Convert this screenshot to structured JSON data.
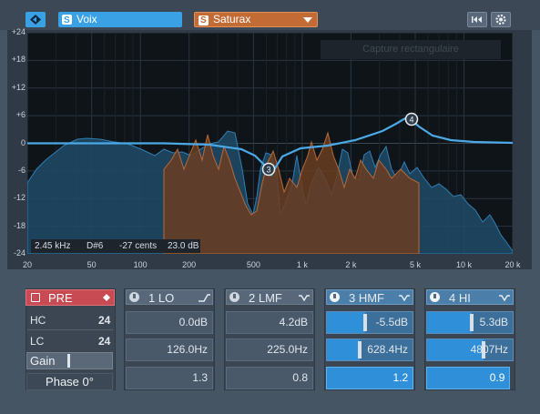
{
  "topbar": {
    "channel_name": "Voix",
    "insert_name": "Saturax",
    "reset_icon": "skip-back-icon",
    "settings_icon": "gear-icon"
  },
  "graph": {
    "y_ticks": [
      "+24",
      "+18",
      "+12",
      "+6",
      "0",
      "-6",
      "-12",
      "-18",
      "-24"
    ],
    "x_ticks": [
      "20",
      "50",
      "100",
      "200",
      "500",
      "1 k",
      "2 k",
      "5 k",
      "10 k",
      "20 k"
    ],
    "tooltip": "Capture rectangulaire",
    "readout": {
      "freq": "2.45 kHz",
      "note": "D#6",
      "cents": "-27 cents",
      "level": "23.0 dB"
    },
    "nodes": [
      {
        "label": "3"
      },
      {
        "label": "4"
      }
    ]
  },
  "pre": {
    "title": "PRE",
    "hc_label": "HC",
    "hc_value": "24",
    "lc_label": "LC",
    "lc_value": "24",
    "gain_label": "Gain",
    "phase_label": "Phase 0°"
  },
  "bands": [
    {
      "name": "1 LO",
      "gain": "0.0dB",
      "freq": "126.0Hz",
      "q": "1.3",
      "active": false
    },
    {
      "name": "2 LMF",
      "gain": "4.2dB",
      "freq": "225.0Hz",
      "q": "0.8",
      "active": false
    },
    {
      "name": "3 HMF",
      "gain": "-5.5dB",
      "freq": "628.4Hz",
      "q": "1.2",
      "active": true
    },
    {
      "name": "4 HI",
      "gain": "5.3dB",
      "freq": "4807Hz",
      "q": "0.9",
      "active": true
    }
  ],
  "colors": {
    "accent": "#3aa2e4",
    "insert": "#c26b34",
    "pre_header": "#c84a53",
    "curve": "#4aa9e6"
  }
}
